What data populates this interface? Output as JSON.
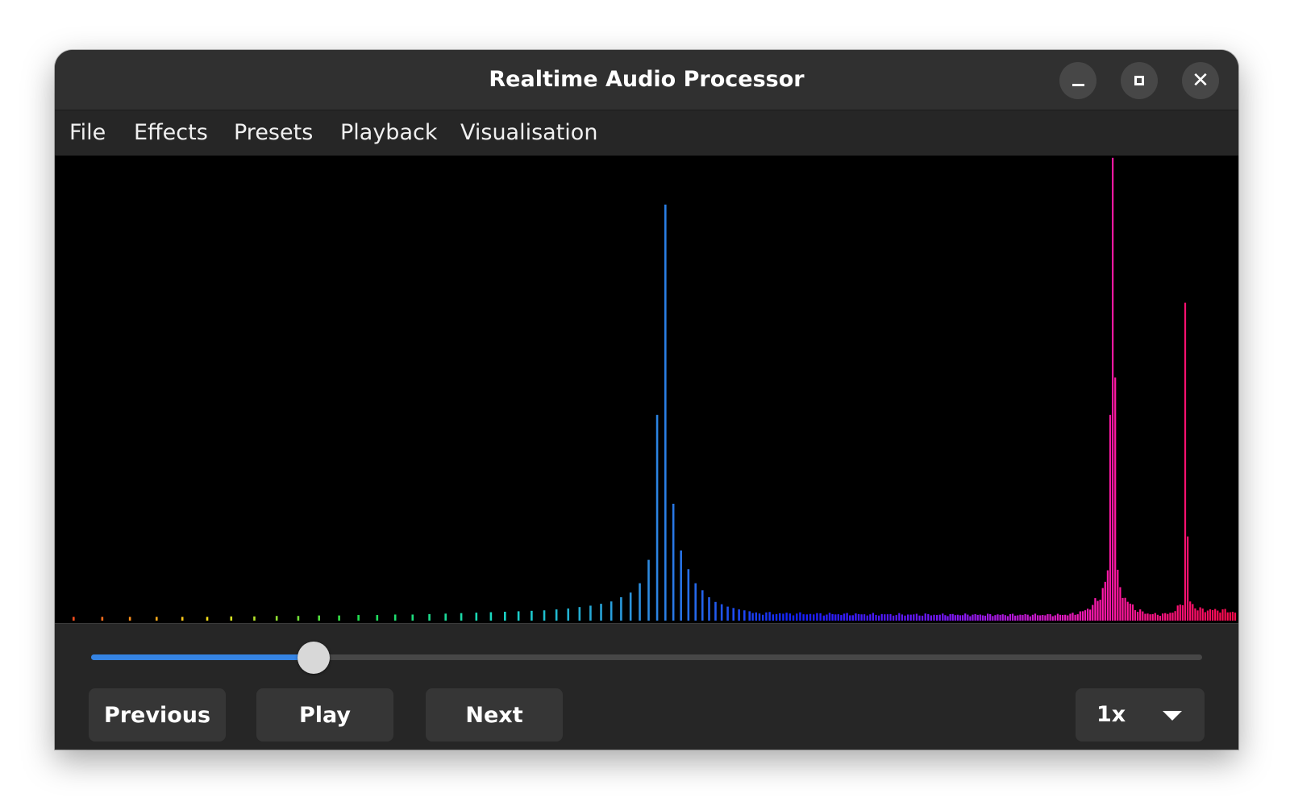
{
  "window": {
    "title": "Realtime Audio Processor",
    "controls": {
      "minimize": "minimize-icon",
      "maximize": "maximize-icon",
      "close": "close-icon"
    }
  },
  "menu": {
    "items": [
      "File",
      "Effects",
      "Presets",
      "Playback",
      "Visualisation"
    ]
  },
  "spectrum": {
    "background": "#000000",
    "colors": [
      "#ff3b1f",
      "#ffe21a",
      "#22e04a",
      "#19d7c7",
      "#2d8be0",
      "#1420ff",
      "#7a18ff",
      "#ff1ab2",
      "#ff0a4a"
    ],
    "low_bars": [
      0.008,
      0.008,
      0.008,
      0.008,
      0.008,
      0.008,
      0.009,
      0.009,
      0.01,
      0.01,
      0.011,
      0.011,
      0.012,
      0.012,
      0.013,
      0.013,
      0.014,
      0.015,
      0.016,
      0.017,
      0.018,
      0.019,
      0.02,
      0.021,
      0.022,
      0.024,
      0.026,
      0.029,
      0.032,
      0.036,
      0.041,
      0.05,
      0.06,
      0.08,
      0.13,
      0.44,
      0.89,
      0.25,
      0.15,
      0.11,
      0.08,
      0.065,
      0.05,
      0.04,
      0.035,
      0.03,
      0.027,
      0.024,
      0.022,
      0.02
    ],
    "peak_1": 0.89,
    "peak_2": 0.99,
    "peak_3": 0.68
  },
  "transport": {
    "position": 0.2,
    "previous_label": "Previous",
    "play_label": "Play",
    "next_label": "Next",
    "speed_value": "1x"
  }
}
